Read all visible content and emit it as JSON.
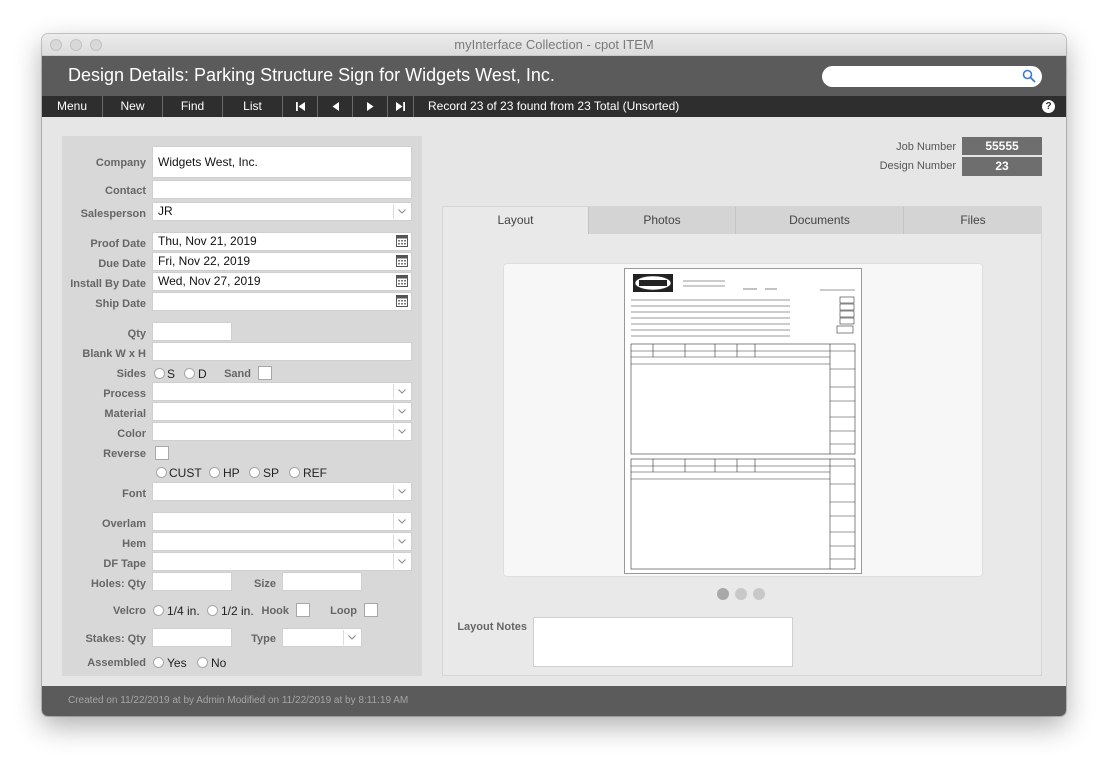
{
  "window": {
    "title": "myInterface Collection - cpot ITEM"
  },
  "header": {
    "title": "Design Details:  Parking Structure Sign for Widgets West, Inc.",
    "search_placeholder": ""
  },
  "toolbar": {
    "menu": "Menu",
    "new": "New",
    "find": "Find",
    "list": "List",
    "record_status": "Record 23 of 23 found from 23 Total (Unsorted)",
    "help": "?"
  },
  "job": {
    "job_number_label": "Job Number",
    "job_number": "55555",
    "design_number_label": "Design Number",
    "design_number": "23"
  },
  "form": {
    "company_label": "Company",
    "company": "Widgets West, Inc.",
    "contact_label": "Contact",
    "contact": "",
    "salesperson_label": "Salesperson",
    "salesperson": "JR",
    "proof_date_label": "Proof Date",
    "proof_date": "Thu, Nov 21, 2019",
    "due_date_label": "Due Date",
    "due_date": "Fri, Nov 22, 2019",
    "install_by_label": "Install By Date",
    "install_by": "Wed, Nov 27, 2019",
    "ship_date_label": "Ship Date",
    "ship_date": "",
    "qty_label": "Qty",
    "qty": "",
    "blank_label": "Blank  W x H",
    "blank": "",
    "sides_label": "Sides",
    "side_s": "S",
    "side_d": "D",
    "sand_label": "Sand",
    "process_label": "Process",
    "process": "",
    "material_label": "Material",
    "material": "",
    "color_label": "Color",
    "color": "",
    "reverse_label": "Reverse",
    "opt_cust": "CUST",
    "opt_hp": "HP",
    "opt_sp": "SP",
    "opt_ref": "REF",
    "font_label": "Font",
    "font": "",
    "overlam_label": "Overlam",
    "overlam": "",
    "hem_label": "Hem",
    "hem": "",
    "dftape_label": "DF Tape",
    "dftape": "",
    "holes_qty_label": "Holes:  Qty",
    "holes_qty": "",
    "size_label": "Size",
    "size": "",
    "velcro_label": "Velcro",
    "velcro_14": "1/4 in.",
    "velcro_12": "1/2 in.",
    "hook_label": "Hook",
    "loop_label": "Loop",
    "stakes_qty_label": "Stakes:  Qty",
    "stakes_qty": "",
    "type_label": "Type",
    "type": "",
    "assembled_label": "Assembled",
    "assembled_yes": "Yes",
    "assembled_no": "No"
  },
  "tabs": [
    {
      "label": "Layout"
    },
    {
      "label": "Photos"
    },
    {
      "label": "Documents"
    },
    {
      "label": "Files"
    }
  ],
  "layout_notes": {
    "label": "Layout Notes",
    "value": ""
  },
  "footer": {
    "text": "Created on 11/22/2019 at  by Admin    Modified on 11/22/2019 at  by 8:11:19 AM"
  },
  "icons": {
    "search": "search-icon",
    "calendar": "calendar-icon",
    "dropdown": "chevron-down-icon",
    "first": "first-record-icon",
    "prev": "previous-record-icon",
    "next": "next-record-icon",
    "last": "last-record-icon"
  }
}
